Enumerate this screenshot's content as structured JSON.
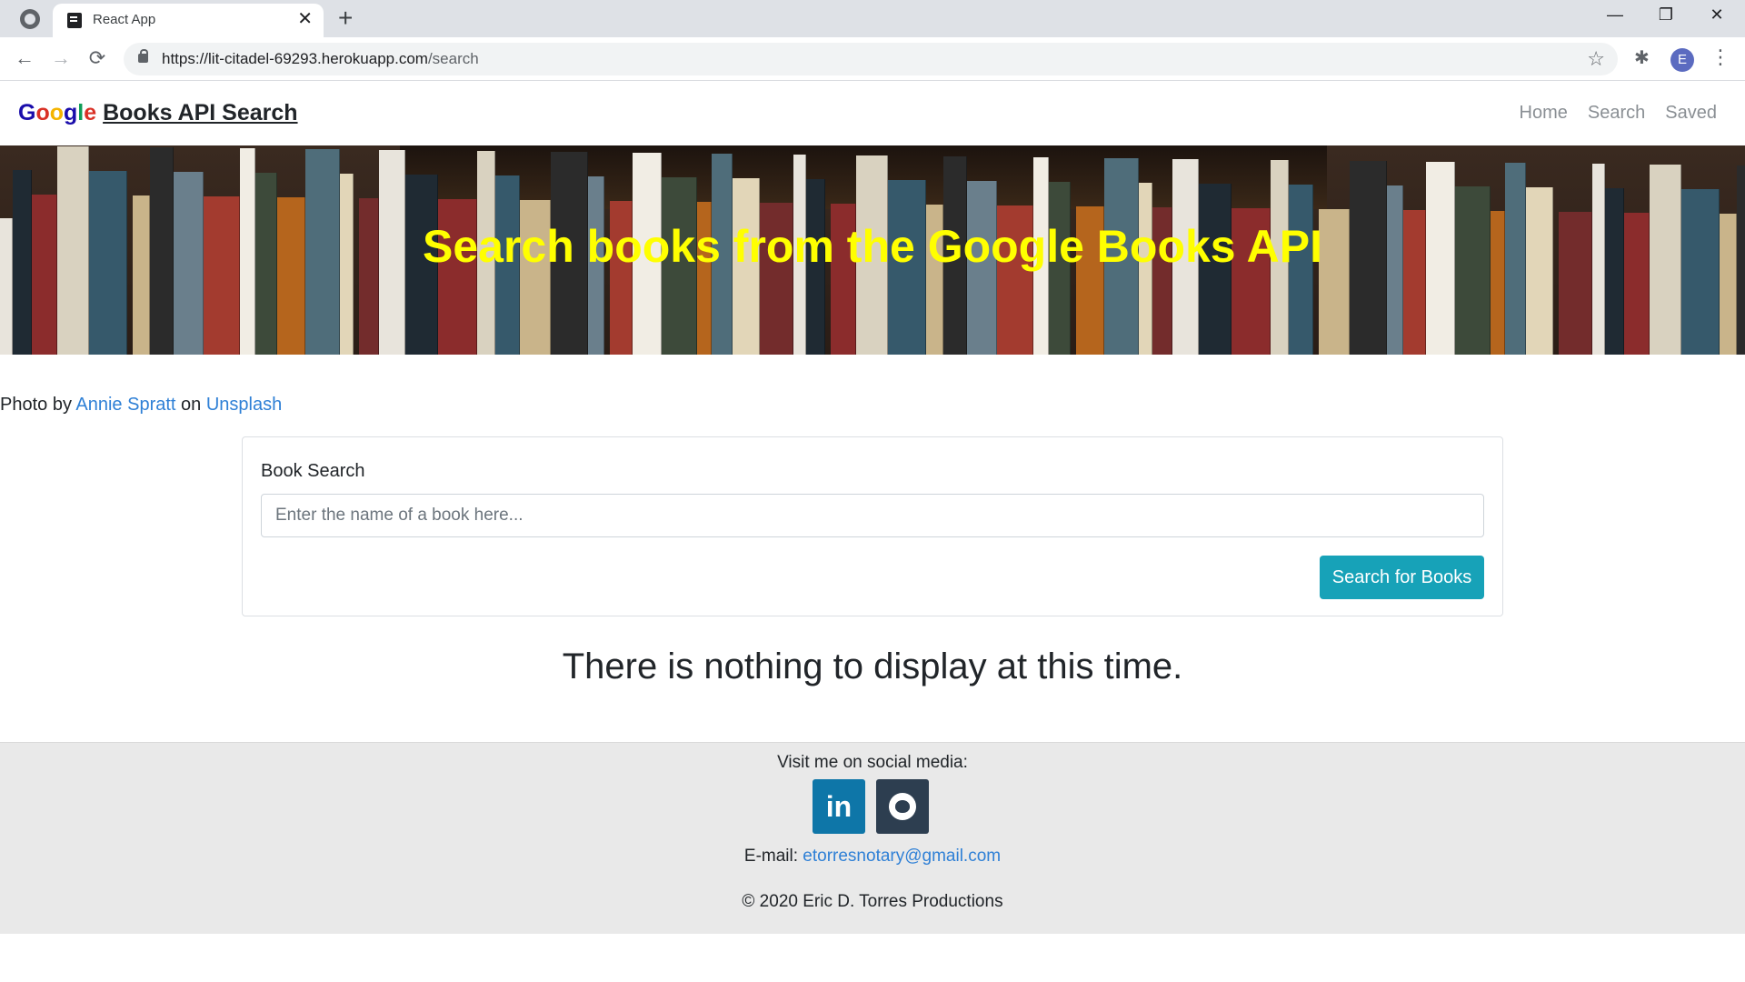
{
  "browser": {
    "tab_title": "React App",
    "url_host": "https://lit-citadel-69293.herokuapp.com",
    "url_path": "/search",
    "profile_initial": "E"
  },
  "navbar": {
    "brand_google": [
      "G",
      "o",
      "o",
      "g",
      "l",
      "e"
    ],
    "brand_text": "Books API Search",
    "links": [
      "Home",
      "Search",
      "Saved"
    ]
  },
  "hero": {
    "title": "Search books from the Google Books API",
    "title_color": "#ffff00"
  },
  "credit": {
    "prefix": "Photo by",
    "author": "Annie Spratt",
    "middle": "on",
    "source": "Unsplash"
  },
  "search": {
    "label": "Book Search",
    "placeholder": "Enter the name of a book here...",
    "value": "",
    "button": "Search for Books",
    "button_color": "#17a2b8"
  },
  "results": {
    "empty_message": "There is nothing to display at this time."
  },
  "footer": {
    "heading": "Visit me on social media:",
    "linkedin_label": "in",
    "email_prefix": "E-mail:",
    "email": "etorresnotary@gmail.com",
    "copyright": "© 2020 Eric D. Torres Productions"
  },
  "colors": {
    "link": "#2f80d6",
    "linkedin": "#0e76a8",
    "github": "#2d3e50"
  }
}
